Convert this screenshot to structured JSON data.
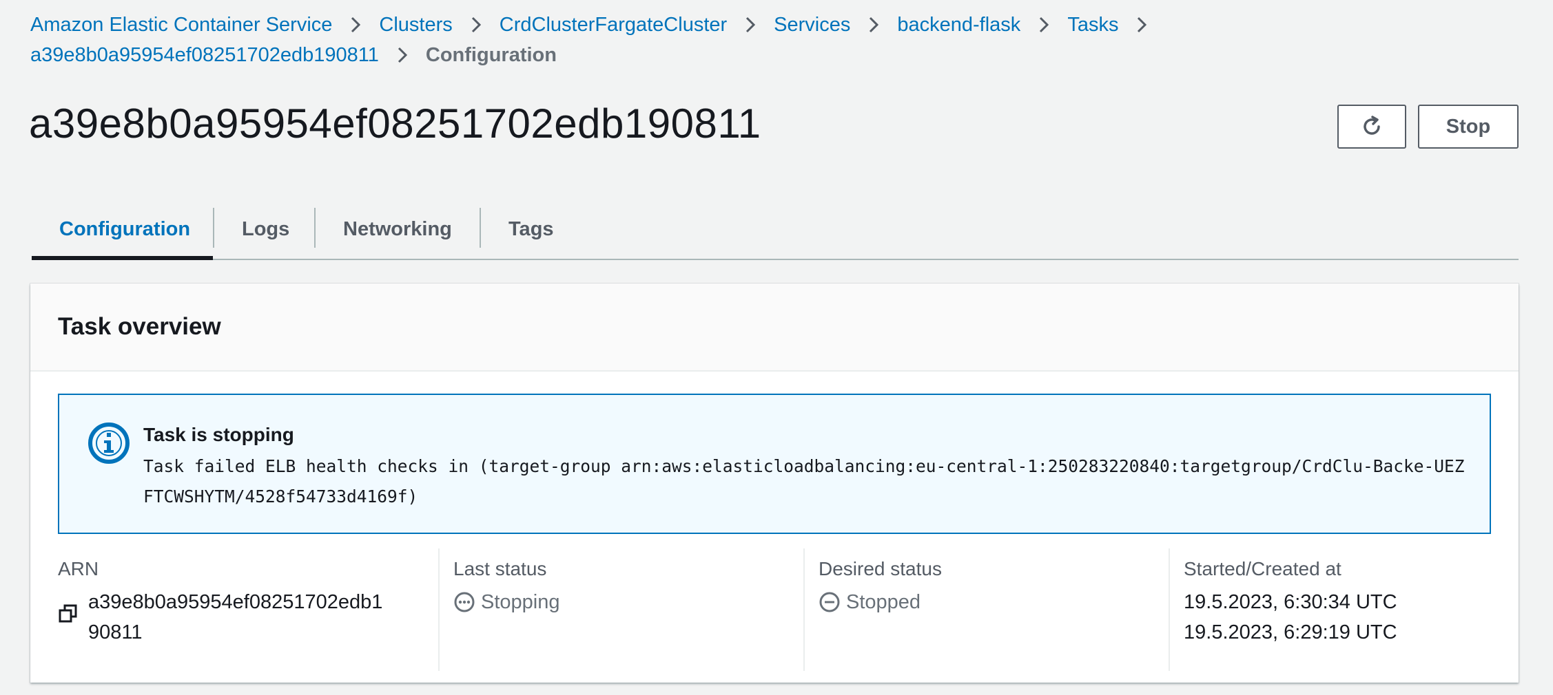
{
  "breadcrumb": {
    "items": [
      {
        "label": "Amazon Elastic Container Service"
      },
      {
        "label": "Clusters"
      },
      {
        "label": "CrdClusterFargateCluster"
      },
      {
        "label": "Services"
      },
      {
        "label": "backend-flask"
      },
      {
        "label": "Tasks"
      },
      {
        "label": "a39e8b0a95954ef08251702edb190811"
      }
    ],
    "current": "Configuration"
  },
  "header": {
    "title": "a39e8b0a95954ef08251702edb190811",
    "refresh_icon": "refresh-icon",
    "stop_label": "Stop"
  },
  "tabs": [
    {
      "label": "Configuration",
      "active": true
    },
    {
      "label": "Logs",
      "active": false
    },
    {
      "label": "Networking",
      "active": false
    },
    {
      "label": "Tags",
      "active": false
    }
  ],
  "task_overview": {
    "title": "Task overview",
    "alert": {
      "icon": "info-icon",
      "title": "Task is stopping",
      "message": "Task failed ELB health checks in (target-group arn:aws:elasticloadbalancing:eu-central-1:250283220840:targetgroup/CrdClu-Backe-UEZFTCWSHYTM/4528f54733d4169f)"
    },
    "fields": {
      "arn_label": "ARN",
      "arn_value": "a39e8b0a95954ef08251702edb190811",
      "last_status_label": "Last status",
      "last_status_value": "Stopping",
      "desired_status_label": "Desired status",
      "desired_status_value": "Stopped",
      "started_label": "Started/Created at",
      "started_value": "19.5.2023, 6:30:34 UTC",
      "created_value": "19.5.2023, 6:29:19 UTC"
    }
  },
  "colors": {
    "link": "#0073bb",
    "background": "#f2f3f3",
    "info_border": "#0073bb",
    "info_background": "#f1faff",
    "status_grey": "#687078"
  }
}
